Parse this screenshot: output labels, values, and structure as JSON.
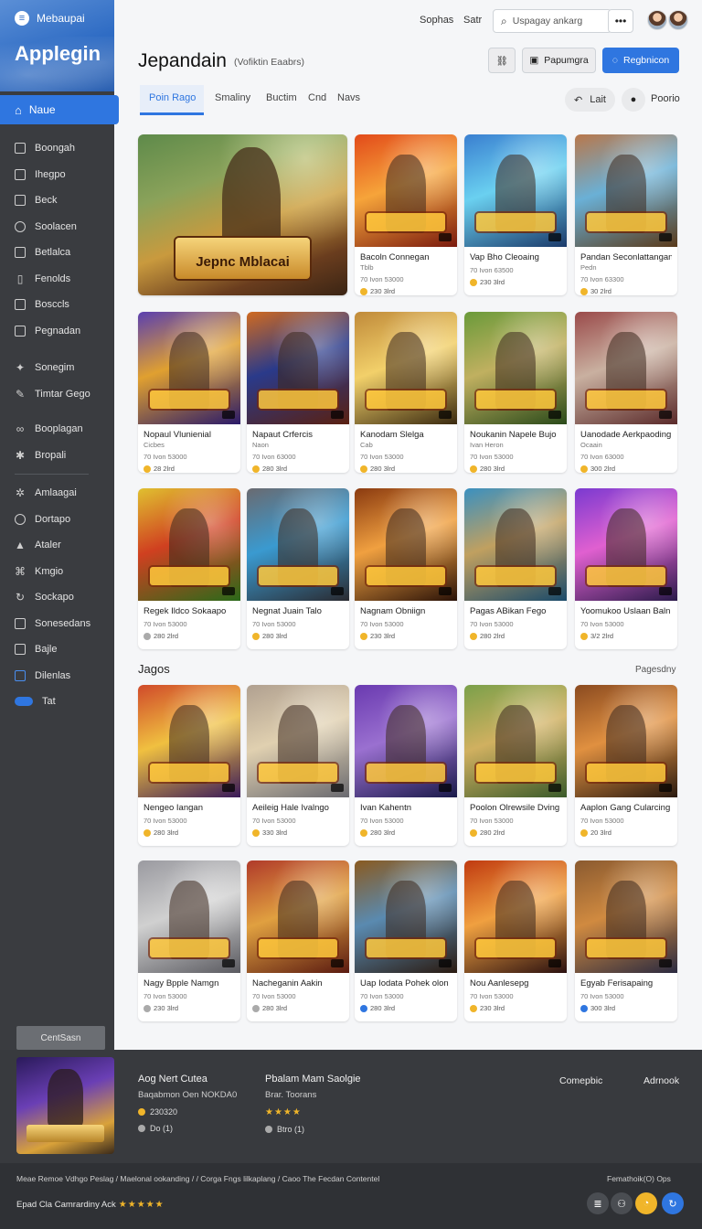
{
  "sidebar": {
    "app_name": "Mebaupai",
    "brand": "Applegin",
    "active_item": {
      "label": "Naue",
      "icon": "home-icon"
    },
    "items": [
      {
        "label": "Boongah",
        "icon": "square-icon"
      },
      {
        "label": "Ihegpo",
        "icon": "square-icon"
      },
      {
        "label": "Beck",
        "icon": "square-icon"
      },
      {
        "label": "Soolacen",
        "icon": "circle-icon"
      },
      {
        "label": "Betlalca",
        "icon": "square-icon"
      },
      {
        "label": "Fenolds",
        "icon": "bars-icon"
      },
      {
        "label": "Bosccls",
        "icon": "square-icon"
      },
      {
        "label": "Pegnadan",
        "icon": "square-icon"
      }
    ],
    "items2": [
      {
        "label": "Sonegim",
        "icon": "star-icon"
      },
      {
        "label": "Timtar Gego",
        "icon": "pencil-icon"
      }
    ],
    "items3": [
      {
        "label": "Booplagan",
        "icon": "link-icon"
      },
      {
        "label": "Bropali",
        "icon": "star-icon"
      }
    ],
    "items4": [
      {
        "label": "Amlaagai",
        "icon": "star-icon"
      },
      {
        "label": "Dortapo",
        "icon": "circle-icon"
      },
      {
        "label": "Ataler",
        "icon": "chart-icon"
      },
      {
        "label": "Kmgio",
        "icon": "puzzle-icon"
      },
      {
        "label": "Sockapo",
        "icon": "refresh-icon"
      },
      {
        "label": "Sonesedans",
        "icon": "square-icon"
      },
      {
        "label": "Bajle",
        "icon": "square-icon"
      },
      {
        "label": "Dilenlas",
        "icon": "square-icon"
      },
      {
        "label": "Tat",
        "icon": "toggle-icon"
      }
    ],
    "bottom_button": "CentSasn"
  },
  "header": {
    "links": [
      "Sophas",
      "Satr"
    ],
    "search_placeholder": "Uspagay ankarg",
    "more": "•••"
  },
  "page": {
    "title": "Jepandain",
    "subtitle": "(Vofiktin Eaabrs)",
    "btn_paper": "Papumgra",
    "btn_primary": "Regbnicon"
  },
  "tabs": {
    "items": [
      "Poin Rago",
      "Smaliny",
      "Buctim",
      "Cnd",
      "Navs"
    ],
    "chip": "Lait",
    "right_label": "Poorio"
  },
  "cards_row1": [
    {
      "title": "Bacoln Connegan",
      "sub": "Tblb",
      "meta": "70 Ivon 53000",
      "price": "230 3lrd",
      "coin": "gold"
    },
    {
      "title": "Vap Bho Cleoaing",
      "sub": "",
      "meta": "70 Ivon 63500",
      "price": "230 3lrd",
      "coin": "gold"
    },
    {
      "title": "Pandan Seconlattangan",
      "sub": "Pedn",
      "meta": "70 Ivon 63300",
      "price": "30 2lrd",
      "coin": "gold"
    }
  ],
  "featured": {
    "title": "Jepnc Mblacai"
  },
  "cards_row2": [
    {
      "title": "Nopaul Vlunienial",
      "sub": "Cicbes",
      "meta": "70 Ivon 53000",
      "price": "28 2lrd",
      "coin": "gold"
    },
    {
      "title": "Napaut Crfercis",
      "sub": "Naon",
      "meta": "70 Ivon 63000",
      "price": "280 3lrd",
      "coin": "gold"
    },
    {
      "title": "Kanodam Slelga",
      "sub": "Cab",
      "meta": "70 Ivon 53000",
      "price": "280 3lrd",
      "coin": "gold"
    },
    {
      "title": "Noukanin Napele Bujo",
      "sub": "Ivan Heron",
      "meta": "70 Ivon 53000",
      "price": "280 3lrd",
      "coin": "gold"
    },
    {
      "title": "Uanodade Aerkpaoding",
      "sub": "Ocaain",
      "meta": "70 Ivon 63000",
      "price": "300 2lrd",
      "coin": "gold"
    }
  ],
  "cards_row3": [
    {
      "title": "Regek Ildco Sokaapo",
      "sub": "",
      "meta": "70 Ivon 53000",
      "price": "280 2lrd",
      "coin": "grey"
    },
    {
      "title": "Negnat Juain Talo",
      "sub": "",
      "meta": "70 Ivon 53000",
      "price": "280 3lrd",
      "coin": "gold"
    },
    {
      "title": "Nagnam Obniign",
      "sub": "",
      "meta": "70 Ivon 53000",
      "price": "230 3lrd",
      "coin": "gold"
    },
    {
      "title": "Pagas ABikan Fego",
      "sub": "",
      "meta": "70 Ivon 53000",
      "price": "280 2lrd",
      "coin": "gold"
    },
    {
      "title": "Yoomukoo Uslaan Baln",
      "sub": "",
      "meta": "70 Ivon 53000",
      "price": "3/2 2lrd",
      "coin": "gold"
    }
  ],
  "section": {
    "title": "Jagos",
    "link": "Pagesdny"
  },
  "cards_row4": [
    {
      "title": "Nengeo Iangan",
      "sub": "",
      "meta": "70 Ivon 53000",
      "price": "280 3lrd",
      "coin": "gold"
    },
    {
      "title": "Aeileig Hale Ivalngo",
      "sub": "",
      "meta": "70 Ivon 53000",
      "price": "330 3lrd",
      "coin": "gold"
    },
    {
      "title": "Ivan Kahentn",
      "sub": "",
      "meta": "70 Ivon 53000",
      "price": "280 3lrd",
      "coin": "gold"
    },
    {
      "title": "Poolon Olrewsile Dving",
      "sub": "",
      "meta": "70 Ivon 53000",
      "price": "280 2lrd",
      "coin": "gold"
    },
    {
      "title": "Aaplon Gang Cularcing",
      "sub": "",
      "meta": "70 Ivon 53000",
      "price": "20 3lrd",
      "coin": "gold"
    }
  ],
  "cards_row5": [
    {
      "title": "Nagy Bpple Namgn",
      "sub": "",
      "meta": "70 Ivon 53000",
      "price": "230 3lrd",
      "coin": "grey"
    },
    {
      "title": "Nacheganin Aakin",
      "sub": "",
      "meta": "70 Ivon 53000",
      "price": "280 3lrd",
      "coin": "grey"
    },
    {
      "title": "Uap Iodata Pohek olon",
      "sub": "",
      "meta": "70 Ivon 53000",
      "price": "280 3lrd",
      "coin": "blue"
    },
    {
      "title": "Nou Aanlesepg",
      "sub": "",
      "meta": "70 Ivon 53000",
      "price": "230 3lrd",
      "coin": "gold"
    },
    {
      "title": "Egyab Ferisapaing",
      "sub": "",
      "meta": "70 Ivon 53000",
      "price": "300 3lrd",
      "coin": "blue"
    }
  ],
  "bottom_panel": {
    "col1_title": "Aog Nert Cutea",
    "col1_sub": "Baqabmon Oen NOKDA0",
    "col1_price": "230320",
    "col1_meta": "Do (1)",
    "col2_title": "Pbalam Mam Saolgie",
    "col2_sub": "Brar. Toorans",
    "col2_stars": "★★★★",
    "col2_meta": "Btro (1)",
    "link1": "Comepbic",
    "link2": "Adrnook"
  },
  "footer": {
    "text": "Meae Remoe Vdhgo Peslag / Maelonal ookanding / / Corga Fngs lilkaplang / Caoo The Fecdan Contentel",
    "right": "Femathoik(O) Ops",
    "rating_text": "Epad Cla Camrardiny Ack",
    "rating_stars": "★★★★★"
  },
  "colors": {
    "accent": "#2f76e0",
    "sidebar": "#3a3c40",
    "gold": "#f0b52a"
  }
}
